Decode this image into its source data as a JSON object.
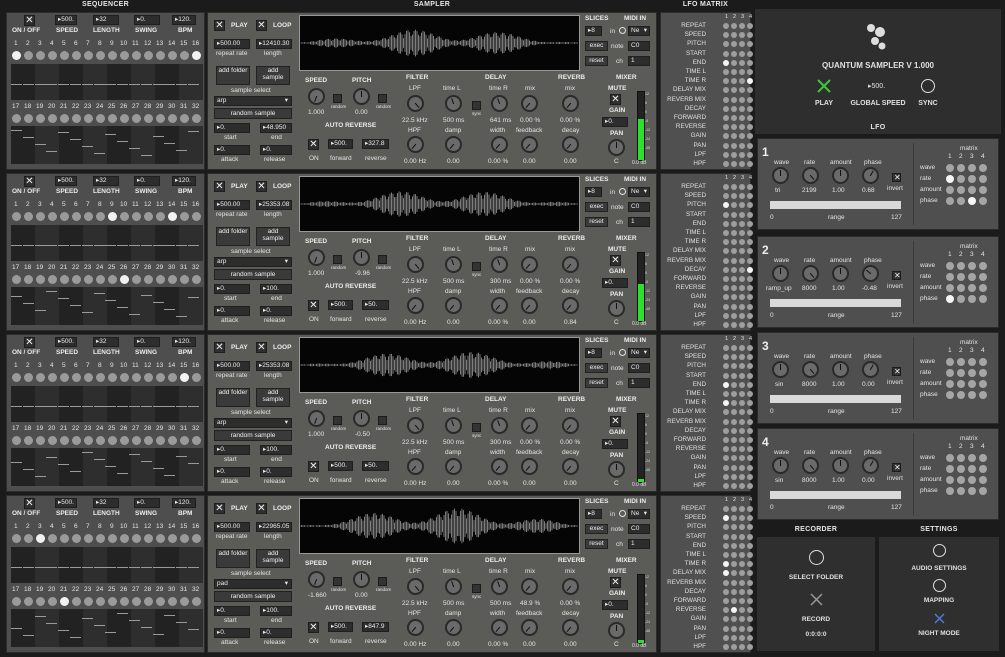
{
  "headers": {
    "sequencer": "SEQUENCER",
    "sampler": "SAMPLER",
    "lfo_matrix": "LFO MATRIX",
    "lfo": "LFO",
    "recorder": "RECORDER",
    "settings": "SETTINGS"
  },
  "seq_labels": {
    "on_off": "ON / OFF",
    "speed": "SPEED",
    "length": "LENGTH",
    "swing": "SWING",
    "bpm": "BPM"
  },
  "step_numbers_top": [
    "1",
    "2",
    "3",
    "4",
    "5",
    "6",
    "7",
    "8",
    "9",
    "10",
    "11",
    "12",
    "13",
    "14",
    "15",
    "16"
  ],
  "step_numbers_bottom": [
    "17",
    "18",
    "19",
    "20",
    "21",
    "22",
    "23",
    "24",
    "25",
    "26",
    "27",
    "28",
    "29",
    "30",
    "31",
    "32"
  ],
  "sampler_labels": {
    "play": "PLAY",
    "loop": "LOOP",
    "repeat_rate": "repeat rate",
    "length": "length",
    "add_folder": "add folder",
    "add_sample": "add sample",
    "sample_select": "sample select",
    "random_sample": "random sample",
    "start": "start",
    "end": "end",
    "attack": "attack",
    "release": "release",
    "speed": "SPEED",
    "pitch": "PITCH",
    "random": "random",
    "auto_reverse": "AUTO REVERSE",
    "on": "ON",
    "forward": "forward",
    "reverse": "reverse",
    "filter": "FILTER",
    "lpf": "LPF",
    "hpf": "HPF",
    "delay": "DELAY",
    "time_l": "time L",
    "time_r": "time R",
    "sync": "sync",
    "mix": "mix",
    "damp": "damp",
    "width": "width",
    "feedback": "feedback",
    "reverb": "REVERB",
    "decay": "decay",
    "mixer": "MIXER",
    "mute": "MUTE",
    "gain": "GAIN",
    "pan": "PAN",
    "pan_c": "C",
    "db": "0.0 dB",
    "slices": "SLICES",
    "midi_in": "MIDI IN",
    "in": "in",
    "exec": "exec",
    "reset": "reset",
    "note": "note",
    "ch": "ch"
  },
  "matrix_cols": [
    "1",
    "2",
    "3",
    "4"
  ],
  "matrix_rows": [
    "REPEAT",
    "SPEED",
    "PITCH",
    "START",
    "END",
    "TIME L",
    "TIME R",
    "DELAY MIX",
    "REVERB MIX",
    "DECAY",
    "FORWARD",
    "REVERSE",
    "GAIN",
    "PAN",
    "LPF",
    "HPF"
  ],
  "tracks": [
    {
      "speed": "500.",
      "length": "32",
      "swing": "0.",
      "bpm": "120.",
      "repeat_rate": "500.00",
      "length_val": "12410.30",
      "sample": "arp",
      "start": "0.",
      "end": "48.950",
      "attack": "0.",
      "release": "0.",
      "speed_val": "1.000",
      "pitch_val": "0.00",
      "ar_fwd": "500.",
      "ar_rev": "327.8",
      "lpf": "22.5 kHz",
      "hpf": "0.00 Hz",
      "time_l": "500 ms",
      "time_r": "641 ms",
      "dmix": "0.00 %",
      "damp": "0.00",
      "width": "0.00 %",
      "feedback": "0.00",
      "rmix": "0.00 %",
      "decay": "0.00",
      "gain": "0.",
      "slices": "8",
      "midi_sel": "Ne",
      "note": "C0",
      "ch": "1",
      "top_on": [
        0,
        15
      ],
      "bot_on": []
    },
    {
      "speed": "500.",
      "length": "32",
      "swing": "0.",
      "bpm": "120.",
      "repeat_rate": "500.00",
      "length_val": "25353.08",
      "sample": "arp",
      "start": "0.",
      "end": "100.",
      "attack": "0.",
      "release": "0.",
      "speed_val": "1.000",
      "pitch_val": "-9.96",
      "ar_fwd": "500.",
      "ar_rev": "50.",
      "lpf": "22.5 kHz",
      "hpf": "0.00 Hz",
      "time_l": "500 ms",
      "time_r": "300 ms",
      "dmix": "0.00 %",
      "damp": "0.00",
      "width": "0.00 %",
      "feedback": "0.00",
      "rmix": "0.00 %",
      "decay": "0.84",
      "gain": "0.",
      "slices": "8",
      "midi_sel": "Ne",
      "note": "C0",
      "ch": "1",
      "top_on": [
        8,
        13
      ],
      "bot_on": [
        9
      ]
    },
    {
      "speed": "500.",
      "length": "32",
      "swing": "0.",
      "bpm": "120.",
      "repeat_rate": "500.00",
      "length_val": "25353.08",
      "sample": "arp",
      "start": "0.",
      "end": "100.",
      "attack": "0.",
      "release": "0.",
      "speed_val": "1.000",
      "pitch_val": "-0.50",
      "ar_fwd": "500.",
      "ar_rev": "50.",
      "lpf": "22.5 kHz",
      "hpf": "0.00 Hz",
      "time_l": "500 ms",
      "time_r": "300 ms",
      "dmix": "0.00 %",
      "damp": "0.00",
      "width": "0.00 %",
      "feedback": "0.00",
      "rmix": "0.00 %",
      "decay": "0.00",
      "gain": "0.",
      "slices": "8",
      "midi_sel": "Ne",
      "note": "C0",
      "ch": "1",
      "top_on": [
        14
      ],
      "bot_on": []
    },
    {
      "speed": "500.",
      "length": "32",
      "swing": "0.",
      "bpm": "120.",
      "repeat_rate": "500.00",
      "length_val": "22965.05",
      "sample": "pad",
      "start": "0.",
      "end": "100.",
      "attack": "0.",
      "release": "0.",
      "speed_val": "-1.660",
      "pitch_val": "0.00",
      "ar_fwd": "500.",
      "ar_rev": "847.9",
      "lpf": "22.5 kHz",
      "hpf": "0.00 Hz",
      "time_l": "500 ms",
      "time_r": "500 ms",
      "dmix": "48.9 %",
      "damp": "0.00",
      "width": "0.00 %",
      "feedback": "0.00",
      "rmix": "0.00 %",
      "decay": "0.00",
      "gain": "0.",
      "slices": "8",
      "midi_sel": "Ne",
      "note": "C0",
      "ch": "1",
      "top_on": [
        2
      ],
      "bot_on": [
        4
      ]
    }
  ],
  "app": {
    "title": "QUANTUM SAMPLER V 1.000",
    "global_speed": "500.",
    "play": "PLAY",
    "global_speed_label": "GLOBAL SPEED",
    "sync": "SYNC"
  },
  "lfo_labels": {
    "wave": "wave",
    "rate": "rate",
    "amount": "amount",
    "phase": "phase",
    "invert": "invert",
    "range": "range",
    "range_min": "0",
    "range_max": "127",
    "matrix": "matrix",
    "m_wave": "wave",
    "m_rate": "rate",
    "m_amount": "amount",
    "m_phase": "phase"
  },
  "lfos": [
    {
      "num": "1",
      "wave": "tri",
      "rate": "2199",
      "amount": "1.00",
      "phase": "0.68"
    },
    {
      "num": "2",
      "wave": "ramp_up",
      "rate": "8000",
      "amount": "1.00",
      "phase": "-0.48"
    },
    {
      "num": "3",
      "wave": "sin",
      "rate": "8000",
      "amount": "1.00",
      "phase": "0.00"
    },
    {
      "num": "4",
      "wave": "sin",
      "rate": "8000",
      "amount": "1.00",
      "phase": "0.00"
    }
  ],
  "recorder": {
    "select_folder": "SELECT FOLDER",
    "record": "RECORD",
    "time": "0:0:0:0"
  },
  "settings": {
    "audio": "AUDIO SETTINGS",
    "mapping": "MAPPING",
    "night": "NIGHT MODE"
  }
}
